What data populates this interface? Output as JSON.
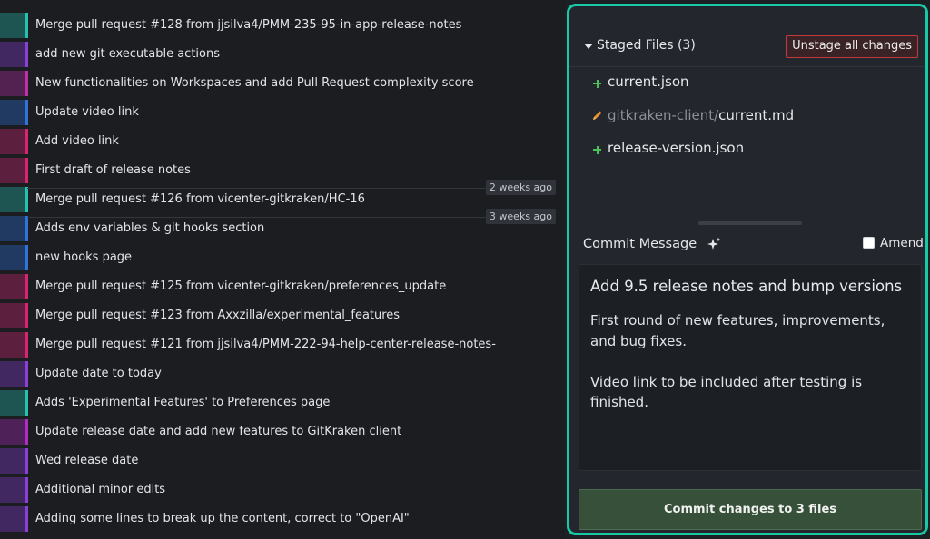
{
  "commits": [
    {
      "message": "Merge pull request #128 from jjsilva4/PMM-235-95-in-app-release-notes",
      "color": "#25c0b0"
    },
    {
      "message": "add new git executable actions",
      "color": "#8a3fd6"
    },
    {
      "message": "New functionalities on Workspaces and add Pull Request complexity score",
      "color": "#c02ea8"
    },
    {
      "message": "Update video link",
      "color": "#2f74d9"
    },
    {
      "message": "Add video link",
      "color": "#d62672"
    },
    {
      "message": "First draft of release notes",
      "color": "#d62672"
    },
    {
      "message": "Merge pull request #126 from vicenter-gitkraken/HC-16",
      "color": "#25c0b0"
    },
    {
      "message": "Adds env variables & git hooks section",
      "color": "#2f74d9"
    },
    {
      "message": "new hooks page",
      "color": "#2f74d9"
    },
    {
      "message": "Merge pull request #125 from vicenter-gitkraken/preferences_update",
      "color": "#d62672"
    },
    {
      "message": "Merge pull request #123 from Axxzilla/experimental_features",
      "color": "#d62672"
    },
    {
      "message": "Merge pull request #121 from jjsilva4/PMM-222-94-help-center-release-notes-",
      "color": "#d62672"
    },
    {
      "message": "Update date to today",
      "color": "#8a3fd6"
    },
    {
      "message": "Adds 'Experimental Features' to Preferences page",
      "color": "#25c0b0"
    },
    {
      "message": "Update release date and add new features to GitKraken client",
      "color": "#b12cc4"
    },
    {
      "message": "Wed release date",
      "color": "#8a3fd6"
    },
    {
      "message": "Additional minor edits",
      "color": "#8a3fd6"
    },
    {
      "message": "Adding some lines to break up the content, correct to \"OpenAI\"",
      "color": "#8a3fd6"
    }
  ],
  "date_badges": [
    "2 weeks ago",
    "3 weeks ago"
  ],
  "staged": {
    "title": "Staged Files (3)",
    "unstage_label": "Unstage all changes",
    "files": [
      {
        "dir": "",
        "name": "current.json",
        "status": "added"
      },
      {
        "dir": "gitkraken-client/",
        "name": "current.md",
        "status": "modified"
      },
      {
        "dir": "",
        "name": "release-version.json",
        "status": "added"
      }
    ]
  },
  "commit_message": {
    "label": "Commit Message",
    "amend_label": "Amend",
    "amend_checked": false,
    "summary": "Add 9.5 release notes and bump versions",
    "description": "First round of new features, improvements,\nand bug fixes.\n\nVideo link to be included after testing is\nfinished."
  },
  "commit_button_label": "Commit changes to 3 files",
  "colors": {
    "panel_border": "#19c9a6",
    "added_icon": "#4cc05a",
    "modified_icon": "#e8952e",
    "unstage_border": "#c23a3a",
    "commit_button": "#37503a"
  }
}
